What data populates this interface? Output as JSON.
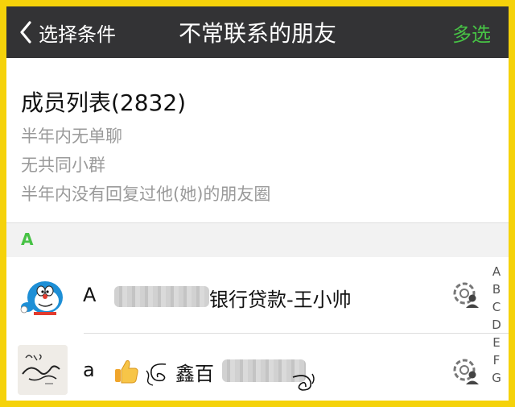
{
  "navbar": {
    "back_label": "选择条件",
    "title": "不常联系的朋友",
    "action_label": "多选",
    "bg_color": "#333335",
    "action_color": "#47c245"
  },
  "summary": {
    "title": "成员列表(2832)",
    "conditions": [
      "半年内无单聊",
      "无共同小群",
      "半年内没有回复过他(她)的朋友圈"
    ]
  },
  "section": {
    "letter": "A"
  },
  "contacts": [
    {
      "prefix": "A",
      "name_visible": "银行贷款-王小帅",
      "avatar": "doraemon-avatar"
    },
    {
      "prefix": "a",
      "name_visible": "鑫百",
      "avatar": "signature-avatar",
      "emoji": "thumbs-up-icon"
    }
  ],
  "alpha_index": [
    "A",
    "B",
    "C",
    "D",
    "E",
    "F",
    "G"
  ],
  "border_color": "#f5d20a"
}
